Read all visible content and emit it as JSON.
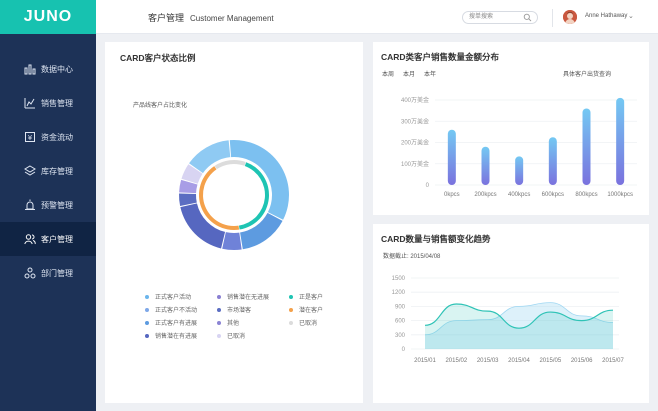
{
  "app": {
    "logo": "JUNO"
  },
  "sidebar": {
    "items": [
      {
        "label": "数据中心",
        "icon": "bar-chart-icon",
        "active": false
      },
      {
        "label": "销售管理",
        "icon": "trend-icon",
        "active": false
      },
      {
        "label": "资金流动",
        "icon": "money-icon",
        "active": false
      },
      {
        "label": "库存管理",
        "icon": "layers-icon",
        "active": false
      },
      {
        "label": "预警管理",
        "icon": "alarm-icon",
        "active": false
      },
      {
        "label": "客户管理",
        "icon": "users-icon",
        "active": true
      },
      {
        "label": "部门管理",
        "icon": "org-icon",
        "active": false
      }
    ]
  },
  "header": {
    "title_cn": "客户管理",
    "title_en": "Customer  Management",
    "search_placeholder": "搜单搜索",
    "user_name": "Anne Hathaway"
  },
  "status_card": {
    "title": "CARD客户状态比例",
    "subtitle": "产品线客户占比变化",
    "legend": [
      {
        "label": "正式客户活动",
        "color": "#6bb5ec"
      },
      {
        "label": "销售潜在无进展",
        "color": "#8a7fd2"
      },
      {
        "label": "正是客户",
        "color": "#1ec4b3"
      },
      {
        "label": "正式客户不活动",
        "color": "#7ea8e8"
      },
      {
        "label": "市场潜客",
        "color": "#5b6dc2"
      },
      {
        "label": "潜在客户",
        "color": "#f4a14b"
      },
      {
        "label": "正式客户有进展",
        "color": "#5d9be0"
      },
      {
        "label": "其他",
        "color": "#8b84d4"
      },
      {
        "label": "已取消",
        "color": "#dcdcdc"
      },
      {
        "label": "销售潜在有进展",
        "color": "#5667c0"
      },
      {
        "label": "已取消",
        "color": "#d8d4f2"
      }
    ]
  },
  "sales_card": {
    "title": "CARD类客户销售数量金额分布",
    "tabs": [
      "本周",
      "本月",
      "本年"
    ],
    "query_link": "具体客户出货查询"
  },
  "trend_card": {
    "title": "CARD数量与销售额变化趋势",
    "deadline": "数据截止: 2015/04/08"
  },
  "chart_data": [
    {
      "type": "pie",
      "title": "CARD客户状态比例",
      "subtitle": "产品线客户占比变化",
      "outer_ring": [
        {
          "label": "正式客户活动",
          "value": 34,
          "color": "#7cc0f0"
        },
        {
          "label": "正式客户不活动",
          "value": 15,
          "color": "#5d9be0"
        },
        {
          "label": "正式客户有进展",
          "value": 6,
          "color": "#6f82d8"
        },
        {
          "label": "销售潜在有进展",
          "value": 18,
          "color": "#5667c0"
        },
        {
          "label": "市场潜客",
          "value": 4,
          "color": "#5b6dc2"
        },
        {
          "label": "其他",
          "value": 4,
          "color": "#a89de6"
        },
        {
          "label": "已取消",
          "value": 5,
          "color": "#d8d4f2"
        },
        {
          "label": "正式客户活动(2)",
          "value": 14,
          "color": "#8fcaf3"
        }
      ],
      "inner_ring": [
        {
          "label": "正是客户",
          "value": 42,
          "color": "#1ec4b3"
        },
        {
          "label": "潜在客户",
          "value": 43,
          "color": "#f4a14b"
        },
        {
          "label": "已取消",
          "value": 15,
          "color": "#dcdcdc"
        }
      ]
    },
    {
      "type": "bar",
      "title": "CARD类客户销售数量金额分布",
      "categories": [
        "0kpcs",
        "200kpcs",
        "400kpcs",
        "600kpcs",
        "800kpcs",
        "1000kpcs"
      ],
      "values": [
        260,
        180,
        135,
        225,
        360,
        410
      ],
      "yticks": [
        "0",
        "100万美金",
        "200万美金",
        "300万美金",
        "400万美金"
      ],
      "ylim": [
        0,
        400
      ]
    },
    {
      "type": "area",
      "title": "CARD数量与销售额变化趋势",
      "categories": [
        "2015/01",
        "2015/02",
        "2015/03",
        "2015/04",
        "2015/05",
        "2015/06",
        "2015/07"
      ],
      "yticks": [
        "0",
        "300",
        "600",
        "900",
        "1200",
        "1500"
      ],
      "ylim": [
        0,
        1500
      ],
      "series": [
        {
          "values": [
            300,
            600,
            620,
            900,
            980,
            700,
            560
          ],
          "color": "#9fd7f2"
        },
        {
          "values": [
            500,
            950,
            800,
            440,
            780,
            600,
            820
          ],
          "color": "#2fc3b6"
        }
      ]
    }
  ]
}
